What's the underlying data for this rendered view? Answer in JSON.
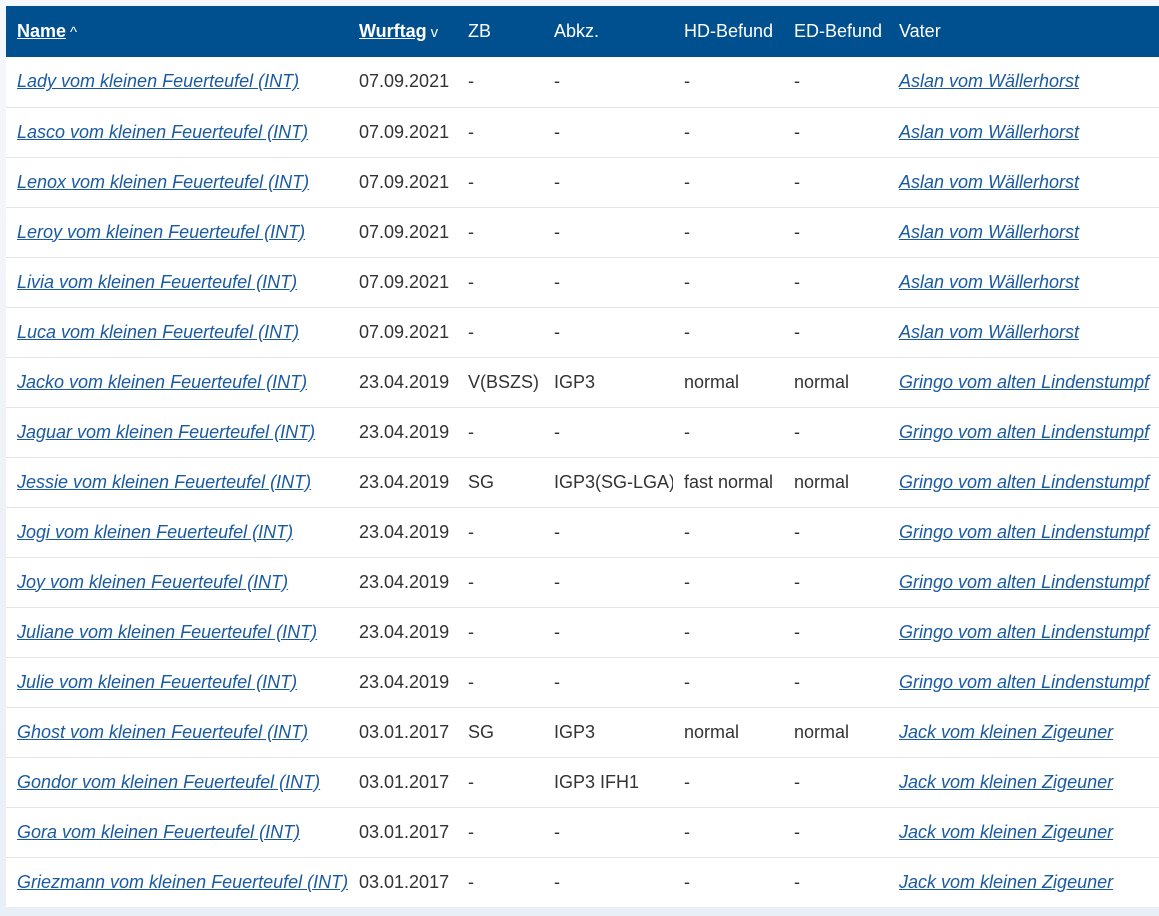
{
  "header": {
    "name": "Name",
    "name_sort": "^",
    "wurftag": "Wurftag",
    "wurftag_sort": "v",
    "zb": "ZB",
    "abkz": "Abkz.",
    "hd": "HD-Befund",
    "ed": "ED-Befund",
    "vater": "Vater"
  },
  "rows": [
    {
      "name": "Lady vom kleinen Feuerteufel (INT)",
      "wurftag": "07.09.2021",
      "zb": "-",
      "abkz": "-",
      "hd": "-",
      "ed": "-",
      "vater": "Aslan vom Wällerhorst"
    },
    {
      "name": "Lasco vom kleinen Feuerteufel (INT)",
      "wurftag": "07.09.2021",
      "zb": "-",
      "abkz": "-",
      "hd": "-",
      "ed": "-",
      "vater": "Aslan vom Wällerhorst"
    },
    {
      "name": "Lenox vom kleinen Feuerteufel (INT)",
      "wurftag": "07.09.2021",
      "zb": "-",
      "abkz": "-",
      "hd": "-",
      "ed": "-",
      "vater": "Aslan vom Wällerhorst"
    },
    {
      "name": "Leroy vom kleinen Feuerteufel (INT)",
      "wurftag": "07.09.2021",
      "zb": "-",
      "abkz": "-",
      "hd": "-",
      "ed": "-",
      "vater": "Aslan vom Wällerhorst"
    },
    {
      "name": "Livia vom kleinen Feuerteufel (INT)",
      "wurftag": "07.09.2021",
      "zb": "-",
      "abkz": "-",
      "hd": "-",
      "ed": "-",
      "vater": "Aslan vom Wällerhorst"
    },
    {
      "name": "Luca vom kleinen Feuerteufel (INT)",
      "wurftag": "07.09.2021",
      "zb": "-",
      "abkz": "-",
      "hd": "-",
      "ed": "-",
      "vater": "Aslan vom Wällerhorst"
    },
    {
      "name": "Jacko vom kleinen Feuerteufel (INT)",
      "wurftag": "23.04.2019",
      "zb": "V(BSZS)",
      "abkz": "IGP3",
      "hd": "normal",
      "ed": "normal",
      "vater": "Gringo vom alten Lindenstumpf"
    },
    {
      "name": "Jaguar vom kleinen Feuerteufel (INT)",
      "wurftag": "23.04.2019",
      "zb": "-",
      "abkz": "-",
      "hd": "-",
      "ed": "-",
      "vater": "Gringo vom alten Lindenstumpf"
    },
    {
      "name": "Jessie vom kleinen Feuerteufel (INT)",
      "wurftag": "23.04.2019",
      "zb": "SG",
      "abkz": "IGP3(SG-LGA)",
      "hd": "fast normal",
      "ed": "normal",
      "vater": "Gringo vom alten Lindenstumpf"
    },
    {
      "name": "Jogi vom kleinen Feuerteufel (INT)",
      "wurftag": "23.04.2019",
      "zb": "-",
      "abkz": "-",
      "hd": "-",
      "ed": "-",
      "vater": "Gringo vom alten Lindenstumpf"
    },
    {
      "name": "Joy vom kleinen Feuerteufel (INT)",
      "wurftag": "23.04.2019",
      "zb": "-",
      "abkz": "-",
      "hd": "-",
      "ed": "-",
      "vater": "Gringo vom alten Lindenstumpf"
    },
    {
      "name": "Juliane vom kleinen Feuerteufel (INT)",
      "wurftag": "23.04.2019",
      "zb": "-",
      "abkz": "-",
      "hd": "-",
      "ed": "-",
      "vater": "Gringo vom alten Lindenstumpf"
    },
    {
      "name": "Julie vom kleinen Feuerteufel (INT)",
      "wurftag": "23.04.2019",
      "zb": "-",
      "abkz": "-",
      "hd": "-",
      "ed": "-",
      "vater": "Gringo vom alten Lindenstumpf"
    },
    {
      "name": "Ghost vom kleinen Feuerteufel (INT)",
      "wurftag": "03.01.2017",
      "zb": "SG",
      "abkz": "IGP3",
      "hd": "normal",
      "ed": "normal",
      "vater": "Jack vom kleinen Zigeuner"
    },
    {
      "name": "Gondor vom kleinen Feuerteufel (INT)",
      "wurftag": "03.01.2017",
      "zb": "-",
      "abkz": "IGP3 IFH1",
      "hd": "-",
      "ed": "-",
      "vater": "Jack vom kleinen Zigeuner"
    },
    {
      "name": "Gora vom kleinen Feuerteufel (INT)",
      "wurftag": "03.01.2017",
      "zb": "-",
      "abkz": "-",
      "hd": "-",
      "ed": "-",
      "vater": "Jack vom kleinen Zigeuner"
    },
    {
      "name": "Griezmann vom kleinen Feuerteufel (INT)",
      "wurftag": "03.01.2017",
      "zb": "-",
      "abkz": "-",
      "hd": "-",
      "ed": "-",
      "vater": "Jack vom kleinen Zigeuner"
    }
  ]
}
